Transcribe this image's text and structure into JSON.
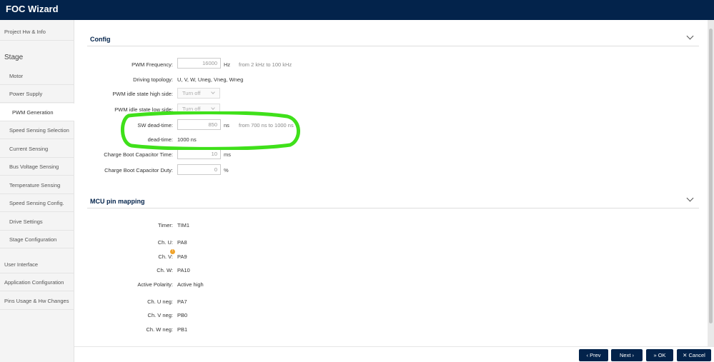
{
  "app": {
    "title": "FOC Wizard"
  },
  "sidebar": {
    "items_top": [
      "Project Hw & Info"
    ],
    "section": "Stage",
    "stage_items": [
      "Motor",
      "Power Supply",
      "PWM Generation",
      "Speed Sensing Selection",
      "Current Sensing",
      "Bus Voltage Sensing",
      "Temperature Sensing",
      "Speed Sensing Config.",
      "Drive Settings",
      "Stage Configuration"
    ],
    "active_item": "PWM Generation",
    "items_bottom": [
      "User Interface",
      "Application Configuration",
      "Pins Usage & Hw Changes"
    ]
  },
  "config": {
    "title": "Config",
    "pwm_frequency": {
      "label": "PWM Frequency:",
      "value": "16000",
      "unit": "Hz",
      "hint": "from 2 kHz to 100 kHz"
    },
    "driving_topology": {
      "label": "Driving topology:",
      "value": "U, V, W, Uneg, Vneg, Wneg"
    },
    "idle_high": {
      "label": "PWM idle state high side:",
      "value": "Turn off"
    },
    "idle_low": {
      "label": "PWM idle state low side:",
      "value": "Turn off"
    },
    "sw_dead_time": {
      "label": "SW dead-time:",
      "value": "850",
      "unit": "ns",
      "hint": "from 700 ns to 1000 ns"
    },
    "dead_time": {
      "label": "dead-time:",
      "value": "1000 ns"
    },
    "boot_time": {
      "label": "Charge Boot Capacitor Time:",
      "value": "10",
      "unit": "ms"
    },
    "boot_duty": {
      "label": "Charge Boot Capacitor Duty:",
      "value": "0",
      "unit": "%"
    }
  },
  "mcu": {
    "title": "MCU pin mapping",
    "timer": {
      "label": "Timer:",
      "value": "TIM1"
    },
    "ch_u": {
      "label": "Ch. U:",
      "value": "PA8"
    },
    "ch_v": {
      "label": "Ch. V:",
      "value": "PA9",
      "badge": "!"
    },
    "ch_w": {
      "label": "Ch. W:",
      "value": "PA10"
    },
    "polarity": {
      "label": "Active Polarity:",
      "value": "Active high"
    },
    "ch_u_neg": {
      "label": "Ch. U neg:",
      "value": "PA7"
    },
    "ch_v_neg": {
      "label": "Ch. V neg:",
      "value": "PB0"
    },
    "ch_w_neg": {
      "label": "Ch. W neg:",
      "value": "PB1"
    }
  },
  "footer": {
    "prev": "Prev",
    "next": "Next",
    "ok": "OK",
    "cancel": "Cancel"
  },
  "colors": {
    "brand": "#03234b",
    "highlight": "#3fe01a",
    "warning": "#f0a32a"
  }
}
